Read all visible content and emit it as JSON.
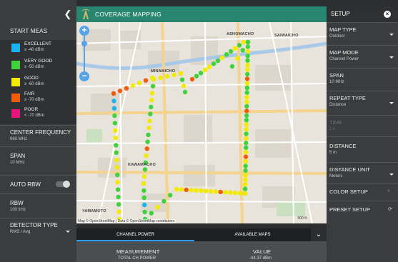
{
  "colors": {
    "excellent": "#18b4ef",
    "very_good": "#3fd23c",
    "good": "#f2ea00",
    "fair": "#f25c0c",
    "poor": "#e6157c",
    "header_green": "#28856f",
    "tab_accent": "#2c9cf5"
  },
  "left_panel": {
    "collapse_icon": "chevron-left-icon",
    "start_label": "START MEAS",
    "legend": [
      {
        "name": "EXCELLENT",
        "value": "≥ -40 dBm",
        "color": "#18b4ef"
      },
      {
        "name": "VERY GOOD",
        "value": "≥ -50 dBm",
        "color": "#3fd23c"
      },
      {
        "name": "GOOD",
        "value": "≥ -60 dBm",
        "color": "#f2ea00"
      },
      {
        "name": "FAIR",
        "value": "≥ -70 dBm",
        "color": "#f25c0c"
      },
      {
        "name": "POOR",
        "value": "< -70 dBm",
        "color": "#e6157c"
      }
    ],
    "center_frequency": {
      "label": "CENTER FREQUENCY",
      "value": "960 MHz"
    },
    "span": {
      "label": "SPAN",
      "value": "10 MHz"
    },
    "auto_rbw": {
      "label": "AUTO RBW",
      "on": true
    },
    "rbw": {
      "label": "RBW",
      "value": "100 kHz"
    },
    "detector_type": {
      "label": "DETECTOR TYPE",
      "value": "RMS / Avg"
    }
  },
  "header": {
    "title": "COVERAGE MAPPING",
    "logo_icon": "tower-icon"
  },
  "map": {
    "labels": [
      "ASHOMACHO",
      "SAIWAICHO",
      "MINAMICHO",
      "KAWAMACHO",
      "YAMAMOTO"
    ],
    "zoom_in": "+",
    "zoom_out": "−",
    "attribution": "Map © OpenStreetMap | Data © OpenStreetMap contributors",
    "scale": "500 ft"
  },
  "tabs": [
    {
      "label": "CHANNEL POWER",
      "active": true
    },
    {
      "label": "AVAILABLE MAPS",
      "active": false
    }
  ],
  "tabs_expand_icon": "chevron-down-icon",
  "table": {
    "columns": [
      "MEASUREMENT",
      "VALUE"
    ],
    "rows": [
      [
        "TOTAL CH POWER",
        "-44.37 dBm"
      ]
    ]
  },
  "right_panel": {
    "title": "SETUP",
    "close_icon": "close-icon",
    "items": [
      {
        "label": "MAP TYPE",
        "value": "Outdoor",
        "dropdown": true
      },
      {
        "label": "MAP MODE",
        "value": "Channel Power",
        "dropdown": true
      },
      {
        "label": "SPAN",
        "value": "10 MHz",
        "dropdown": false
      },
      {
        "label": "REPEAT TYPE",
        "value": "Distance",
        "dropdown": true
      },
      {
        "label": "TIME",
        "value": "1 s",
        "dropdown": false,
        "disabled": true
      },
      {
        "label": "DISTANCE",
        "value": "5 m",
        "dropdown": false
      },
      {
        "label": "DISTANCE UNIT",
        "value": "Meters",
        "dropdown": true
      },
      {
        "label": "COLOR SETUP",
        "value": "",
        "glyph": "›"
      },
      {
        "label": "PRESET SETUP",
        "value": "",
        "glyph": "⟳"
      }
    ]
  }
}
